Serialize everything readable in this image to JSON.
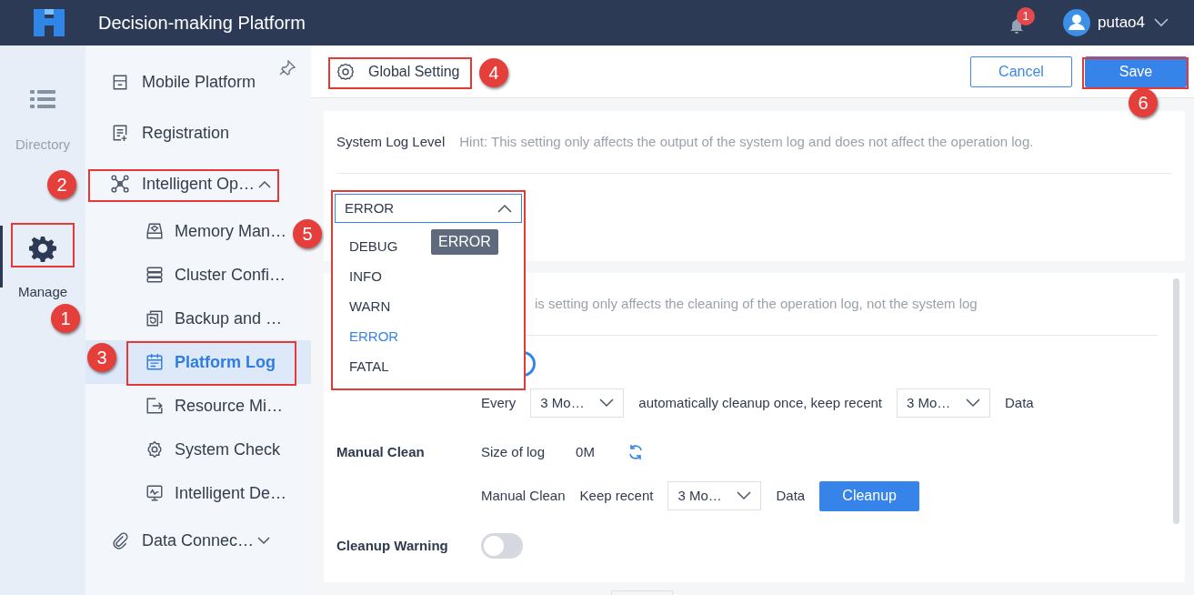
{
  "header": {
    "title": "Decision-making Platform",
    "notification_count": "1",
    "user": "putao4"
  },
  "rail": [
    {
      "label": "Directory",
      "selected": false
    },
    {
      "label": "Manage",
      "selected": true
    }
  ],
  "sidebar": {
    "items": [
      {
        "label": "Mobile Platform",
        "selected": false
      },
      {
        "label": "Registration",
        "selected": false
      },
      {
        "label": "Intelligent Op…",
        "selected": false,
        "expanded": true,
        "children": [
          {
            "label": "Memory Man…",
            "selected": false
          },
          {
            "label": "Cluster Confi…",
            "selected": false
          },
          {
            "label": "Backup and …",
            "selected": false
          },
          {
            "label": "Platform Log",
            "selected": true
          },
          {
            "label": "Resource Mi…",
            "selected": false
          },
          {
            "label": "System Check",
            "selected": false
          },
          {
            "label": "Intelligent De…",
            "selected": false
          }
        ]
      },
      {
        "label": "Data Connec…",
        "selected": false,
        "expanded": false
      }
    ]
  },
  "toolbar": {
    "title": "Global Setting",
    "buttons": [
      "Cancel",
      "Save"
    ]
  },
  "system_log": {
    "label": "System Log Level",
    "hint": "Hint: This setting only affects the output of the system log and does not affect the operation log.",
    "select": {
      "value": "ERROR",
      "expanded": true,
      "tooltip": "ERROR",
      "options": [
        {
          "label": "DEBUG",
          "selected": false
        },
        {
          "label": "INFO",
          "selected": false
        },
        {
          "label": "WARN",
          "selected": false
        },
        {
          "label": "ERROR",
          "selected": true
        },
        {
          "label": "FATAL",
          "selected": false
        }
      ]
    }
  },
  "operation_log": {
    "hint": "is setting only affects the cleaning of the operation log, not the system log",
    "auto_clean_on": true,
    "auto_row": {
      "every": "Every",
      "interval": "3 Mo…",
      "middle": "automatically cleanup once, keep recent",
      "keep": "3 Mo…",
      "suffix": "Data"
    },
    "manual": {
      "label": "Manual Clean",
      "size_label": "Size of log",
      "size": "0M",
      "clean_label": "Manual Clean",
      "keep_label": "Keep recent",
      "keep": "3 Mo…",
      "suffix": "Data",
      "button": "Cleanup"
    },
    "warning": {
      "label": "Cleanup Warning",
      "on": false
    }
  },
  "callouts": [
    "1",
    "2",
    "3",
    "4",
    "5",
    "6"
  ]
}
